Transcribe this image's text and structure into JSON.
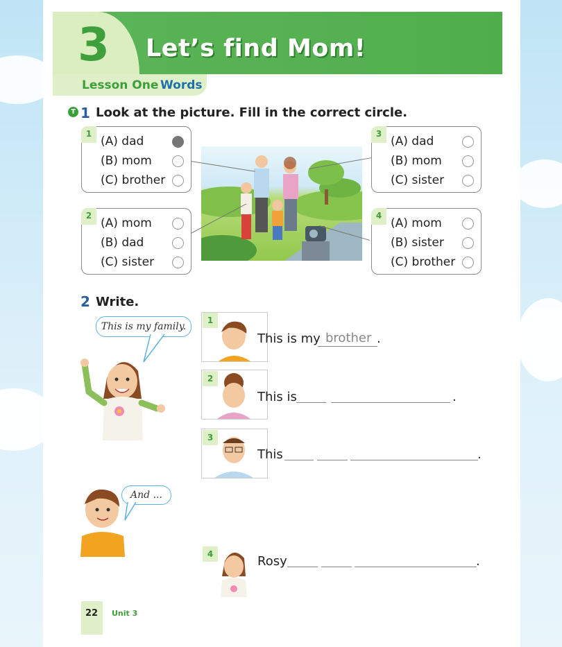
{
  "header": {
    "unit_number": "3",
    "title": "Let’s find Mom!"
  },
  "lesson": {
    "part1": "Lesson One",
    "part2": "Words"
  },
  "section1": {
    "number": "1",
    "instruction": "Look at the picture. Fill in the correct circle.",
    "questions": [
      {
        "num": "1",
        "options": [
          "(A)  dad",
          "(B)  mom",
          "(C)  brother"
        ],
        "selected": 0
      },
      {
        "num": "2",
        "options": [
          "(A)  mom",
          "(B)  dad",
          "(C)  sister"
        ],
        "selected": null
      },
      {
        "num": "3",
        "options": [
          "(A)  dad",
          "(B)  mom",
          "(C)  sister"
        ],
        "selected": null
      },
      {
        "num": "4",
        "options": [
          "(A)  mom",
          "(B)  sister",
          "(C)  brother"
        ],
        "selected": null
      }
    ]
  },
  "section2": {
    "number": "2",
    "instruction": "Write.",
    "girl_bubble": "This is my family.",
    "boy_bubble": "And ...",
    "items": [
      {
        "num": "1",
        "text": "This is my",
        "answer": "brother",
        "end": "."
      },
      {
        "num": "2",
        "text": "This is",
        "end": "."
      },
      {
        "num": "3",
        "text": "This",
        "end": "."
      },
      {
        "num": "4",
        "text": "Rosy",
        "end": "."
      }
    ]
  },
  "footer": {
    "page": "22",
    "unit": "Unit 3"
  },
  "colors": {
    "green": "#4fae4b",
    "light_green": "#dff0c9",
    "blue": "#2a5f9e"
  }
}
